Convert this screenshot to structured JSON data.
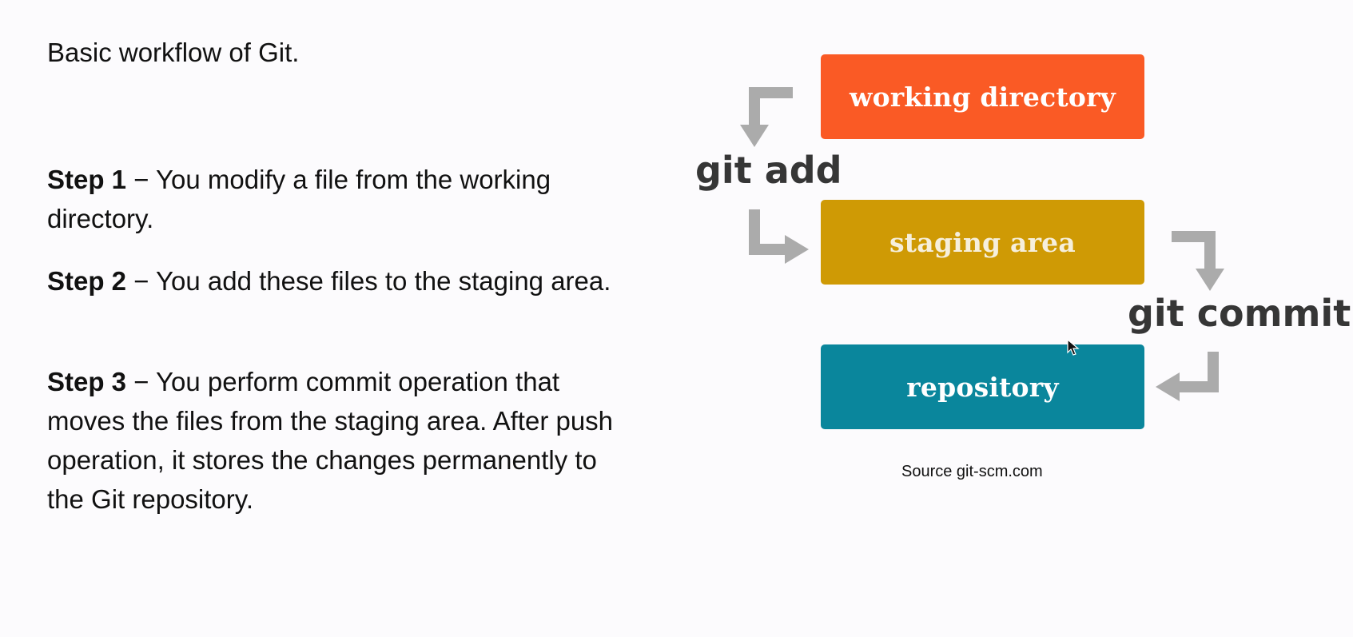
{
  "heading": "Basic workflow of Git.",
  "steps": [
    {
      "label": "Step 1",
      "text": " − You modify a file from the working directory."
    },
    {
      "label": "Step 2",
      "text": " − You add these files to the staging area."
    },
    {
      "label": "Step 3",
      "text": " − You perform commit operation that moves the files from the staging area. After push operation, it stores the changes permanently to the Git repository."
    }
  ],
  "diagram": {
    "boxes": {
      "working_directory": "working directory",
      "staging_area": "staging area",
      "repository": "repository"
    },
    "commands": {
      "add": "git add",
      "commit": "git commit"
    },
    "source": "Source git-scm.com",
    "colors": {
      "working_directory": "#fa5a25",
      "staging_area": "#cf9a05",
      "repository": "#0a869c",
      "arrows": "#ababab"
    }
  }
}
